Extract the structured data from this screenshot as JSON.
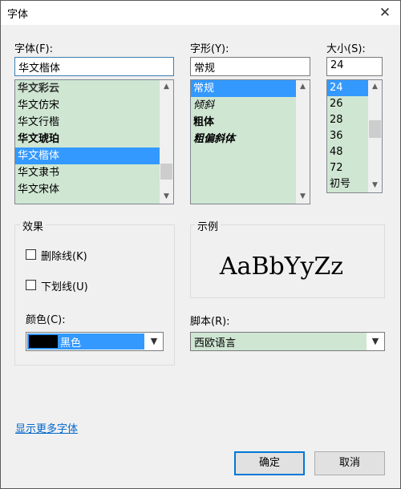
{
  "window": {
    "title": "字体",
    "close_glyph": "✕"
  },
  "font": {
    "label": "字体(F):",
    "value": "华文楷体",
    "items": [
      "华文彩云",
      "华文仿宋",
      "华文行楷",
      "华文琥珀",
      "华文楷体",
      "华文隶书",
      "华文宋体"
    ],
    "selected": "华文楷体"
  },
  "style": {
    "label": "字形(Y):",
    "value": "常规",
    "items": [
      "常规",
      "倾斜",
      "粗体",
      "粗偏斜体"
    ],
    "selected": "常规"
  },
  "size": {
    "label": "大小(S):",
    "value": "24",
    "items": [
      "24",
      "26",
      "28",
      "36",
      "48",
      "72",
      "初号"
    ],
    "selected": "24"
  },
  "effects": {
    "title": "效果",
    "strikeout_label": "删除线(K)",
    "strikeout_checked": false,
    "underline_label": "下划线(U)",
    "underline_checked": false,
    "color_label": "颜色(C):",
    "color_value": "黑色",
    "color_swatch": "#000000"
  },
  "sample": {
    "title": "示例",
    "text": "AaBbYyZz"
  },
  "script": {
    "label": "脚本(R):",
    "value": "西欧语言"
  },
  "more_fonts_link": "显示更多字体",
  "buttons": {
    "ok": "确定",
    "cancel": "取消"
  },
  "colors": {
    "selection": "#3399ff",
    "list_bg": "#cfe6d3",
    "link": "#0066cc",
    "default_border": "#0078d7"
  }
}
